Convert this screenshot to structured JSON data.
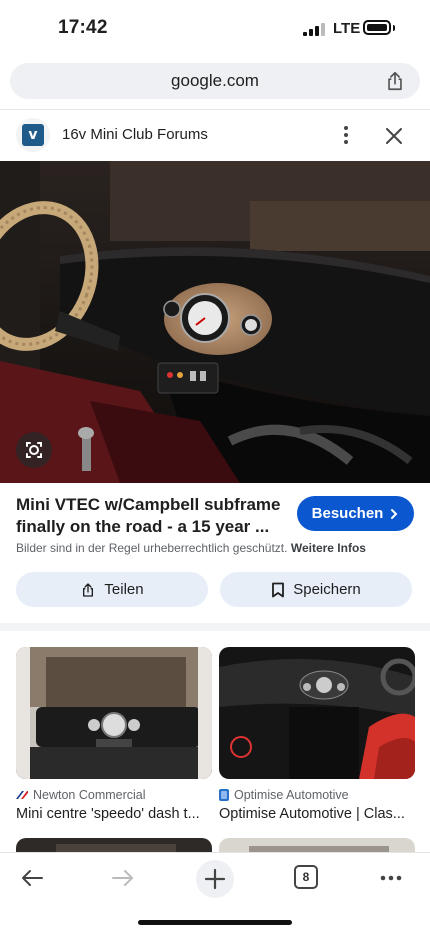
{
  "status_bar": {
    "time": "17:42",
    "network": "LTE"
  },
  "browser": {
    "url": "google.com",
    "open_tabs": "8"
  },
  "source": {
    "title": "16v Mini Club Forums"
  },
  "result": {
    "title": "Mini VTEC w/Campbell subframe finally on the road - a 15 year ...",
    "visit_label": "Besuchen",
    "copyright_text": "Bilder sind in der Regel urheberrechtlich geschützt.",
    "more_info_label": "Weitere Infos",
    "share_label": "Teilen",
    "save_label": "Speichern"
  },
  "related": [
    {
      "source": "Newton Commercial",
      "title": "Mini centre 'speedo' dash t..."
    },
    {
      "source": "Optimise Automotive",
      "title": "Optimise Automotive | Clas..."
    }
  ],
  "icons": {
    "share": "share-icon",
    "more": "more-vert-icon",
    "close": "close-icon",
    "lens": "lens-icon",
    "back": "back-arrow-icon",
    "forward": "forward-arrow-icon",
    "new_tab": "plus-icon",
    "menu": "more-horiz-icon"
  },
  "colors": {
    "accent": "#0b57d0",
    "chip_bg": "#e8eef8"
  }
}
